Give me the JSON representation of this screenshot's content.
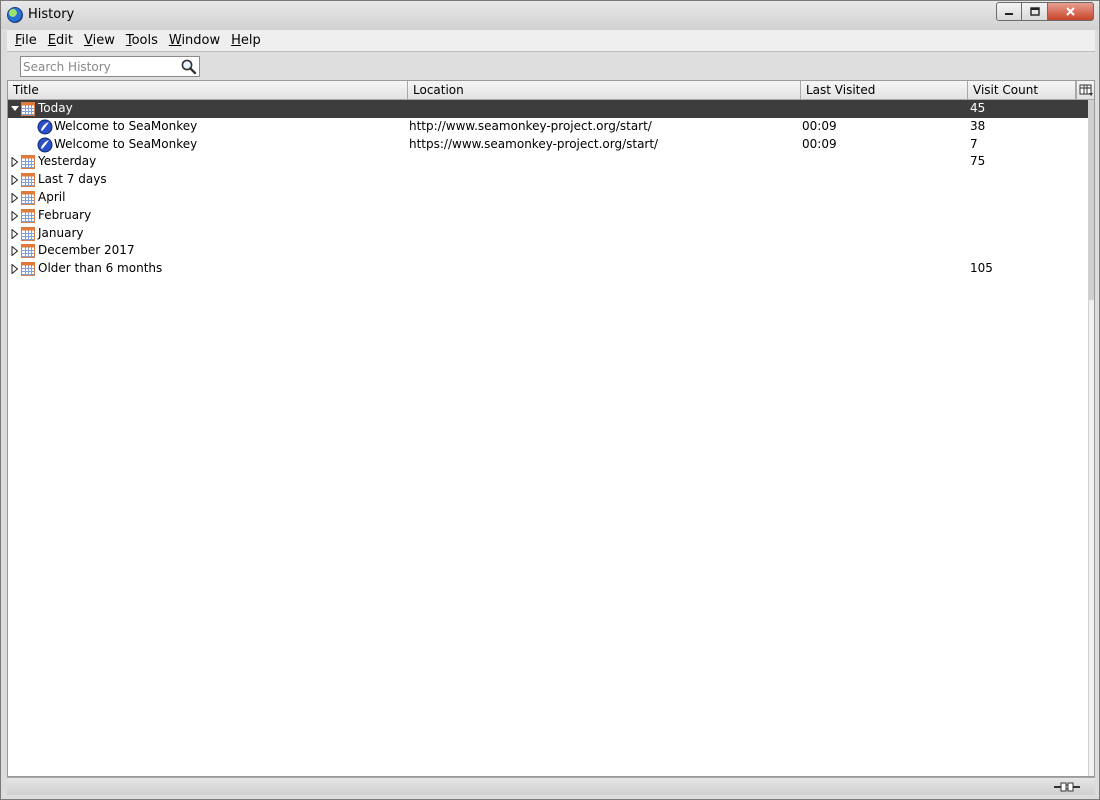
{
  "window": {
    "title": "History"
  },
  "menu": [
    {
      "label": "File",
      "mnemonic": "F",
      "rest": "ile"
    },
    {
      "label": "Edit",
      "mnemonic": "E",
      "rest": "dit"
    },
    {
      "label": "View",
      "mnemonic": "V",
      "rest": "iew"
    },
    {
      "label": "Tools",
      "mnemonic": "T",
      "rest": "ools"
    },
    {
      "label": "Window",
      "mnemonic": "W",
      "rest": "indow"
    },
    {
      "label": "Help",
      "mnemonic": "H",
      "rest": "elp"
    }
  ],
  "search": {
    "placeholder": "Search History",
    "value": ""
  },
  "columns": {
    "title": "Title",
    "location": "Location",
    "last_visited": "Last Visited",
    "visit_count": "Visit Count"
  },
  "rows": [
    {
      "title": "Today",
      "location": "",
      "last_visited": "",
      "visit_count": "45",
      "level": 0,
      "expanded": true,
      "selected": true
    },
    {
      "title": "Welcome to SeaMonkey",
      "location": "http://www.seamonkey-project.org/start/",
      "last_visited": "00:09",
      "visit_count": "38",
      "level": 1
    },
    {
      "title": "Welcome to SeaMonkey",
      "location": "https://www.seamonkey-project.org/start/",
      "last_visited": "00:09",
      "visit_count": "7",
      "level": 1
    },
    {
      "title": "Yesterday",
      "location": "",
      "last_visited": "",
      "visit_count": "75",
      "level": 0,
      "expanded": false
    },
    {
      "title": "Last 7 days",
      "location": "",
      "last_visited": "",
      "visit_count": "",
      "level": 0,
      "expanded": false
    },
    {
      "title": "April",
      "location": "",
      "last_visited": "",
      "visit_count": "",
      "level": 0,
      "expanded": false
    },
    {
      "title": "February",
      "location": "",
      "last_visited": "",
      "visit_count": "",
      "level": 0,
      "expanded": false
    },
    {
      "title": "January",
      "location": "",
      "last_visited": "",
      "visit_count": "",
      "level": 0,
      "expanded": false
    },
    {
      "title": "December 2017",
      "location": "",
      "last_visited": "",
      "visit_count": "",
      "level": 0,
      "expanded": false
    },
    {
      "title": "Older than 6 months",
      "location": "",
      "last_visited": "",
      "visit_count": "105",
      "level": 0,
      "expanded": false
    }
  ],
  "icons": {
    "app": "seamonkey-globe-icon",
    "search": "magnifier-icon",
    "folder": "calendar-icon",
    "page": "seamonkey-page-icon",
    "column_picker": "column-picker-icon",
    "status": "plug-icon"
  },
  "colors": {
    "selection": "#3d3d3d",
    "calendar": "#e07a3a",
    "page_icon": "#2a50c8"
  }
}
